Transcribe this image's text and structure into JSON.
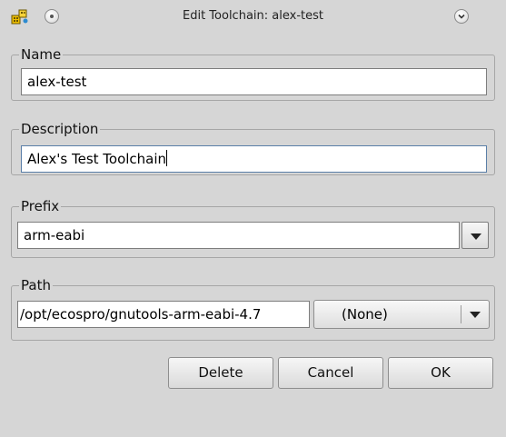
{
  "window": {
    "title": "Edit Toolchain: alex-test"
  },
  "name_group": {
    "label": "Name",
    "value": "alex-test"
  },
  "description_group": {
    "label": "Description",
    "value": "Alex's Test Toolchain"
  },
  "prefix_group": {
    "label": "Prefix",
    "value": "arm-eabi"
  },
  "path_group": {
    "label": "Path",
    "value": "/opt/ecospro/gnutools-arm-eabi-4.7",
    "selector_value": "(None)"
  },
  "buttons": {
    "delete": "Delete",
    "cancel": "Cancel",
    "ok": "OK"
  }
}
